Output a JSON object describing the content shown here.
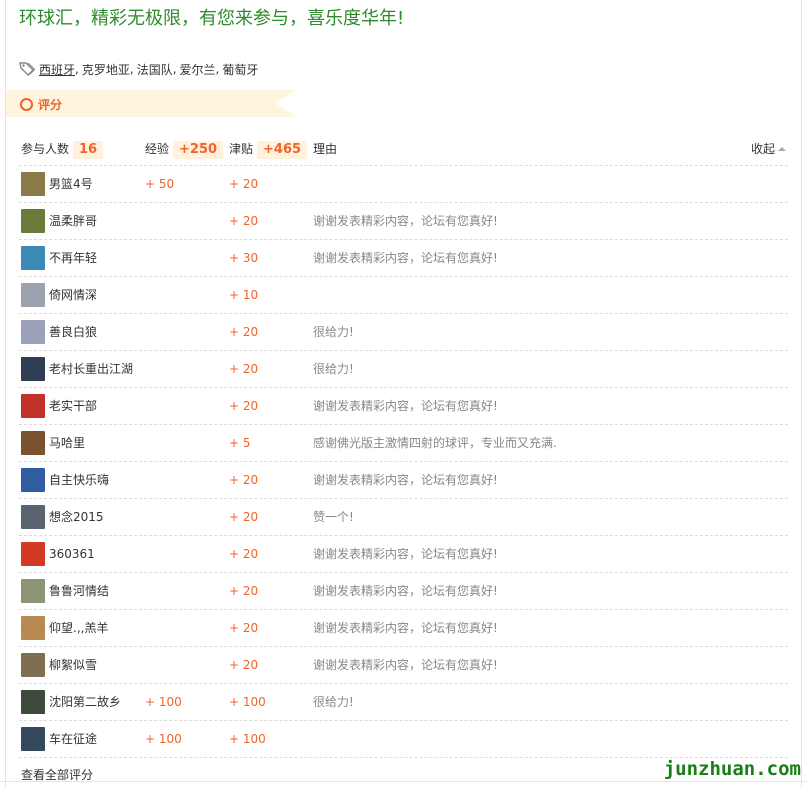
{
  "headline": "环球汇，精彩无极限，有您来参与，喜乐度华年!",
  "tags": [
    "西班牙",
    "克罗地亚",
    "法国队",
    "爱尔兰",
    "葡萄牙"
  ],
  "tag_separator": ",",
  "rate": {
    "title": "评分",
    "headers": {
      "participants_label": "参与人数",
      "participants_count": "16",
      "exp_label": "经验",
      "exp_total": "+250",
      "jt_label": "津贴",
      "jt_total": "+465",
      "reason_label": "理由",
      "collapse_label": "收起"
    },
    "rows": [
      {
        "name": "男篮4号",
        "exp": "+ 50",
        "jt": "+ 20",
        "reason": "",
        "avatar_color": "#8a7a4a",
        "avatar_icon": "avatar-photo-icon"
      },
      {
        "name": "温柔胖哥",
        "exp": "",
        "jt": "+ 20",
        "reason": "谢谢发表精彩内容，论坛有您真好!",
        "avatar_color": "#6b7b3a",
        "avatar_icon": "avatar-photo-icon"
      },
      {
        "name": "不再年轻",
        "exp": "",
        "jt": "+ 30",
        "reason": "谢谢发表精彩内容，论坛有您真好!",
        "avatar_color": "#3a8ab5",
        "avatar_icon": "avatar-photo-icon"
      },
      {
        "name": "倚网情深",
        "exp": "",
        "jt": "+ 10",
        "reason": "",
        "avatar_color": "#9aa3ad",
        "avatar_icon": "avatar-photo-icon"
      },
      {
        "name": "善良白狼",
        "exp": "",
        "jt": "+ 20",
        "reason": "很给力!",
        "avatar_color": "#9ba1b8",
        "avatar_icon": "avatar-photo-icon"
      },
      {
        "name": "老村长重出江湖",
        "exp": "",
        "jt": "+ 20",
        "reason": "很给力!",
        "avatar_color": "#2d3e55",
        "avatar_icon": "avatar-photo-icon"
      },
      {
        "name": "老实干部",
        "exp": "",
        "jt": "+ 20",
        "reason": "谢谢发表精彩内容，论坛有您真好!",
        "avatar_color": "#c2302a",
        "avatar_icon": "avatar-photo-icon"
      },
      {
        "name": "马哈里",
        "exp": "",
        "jt": "+ 5",
        "reason": "感谢佛光版主激情四射的球评，专业而又充满.",
        "avatar_color": "#7a5230",
        "avatar_icon": "avatar-photo-icon"
      },
      {
        "name": "自主快乐嗨",
        "exp": "",
        "jt": "+ 20",
        "reason": "谢谢发表精彩内容，论坛有您真好!",
        "avatar_color": "#2f5fa0",
        "avatar_icon": "avatar-photo-icon"
      },
      {
        "name": "想念2015",
        "exp": "",
        "jt": "+ 20",
        "reason": "赞一个!",
        "avatar_color": "#5a6470",
        "avatar_icon": "avatar-photo-icon"
      },
      {
        "name": "360361",
        "exp": "",
        "jt": "+ 20",
        "reason": "谢谢发表精彩内容，论坛有您真好!",
        "avatar_color": "#d23a24",
        "avatar_icon": "avatar-photo-icon"
      },
      {
        "name": "鲁鲁河情结",
        "exp": "",
        "jt": "+ 20",
        "reason": "谢谢发表精彩内容，论坛有您真好!",
        "avatar_color": "#8c9478",
        "avatar_icon": "avatar-photo-icon"
      },
      {
        "name": "仰望.,,羔羊",
        "exp": "",
        "jt": "+ 20",
        "reason": "谢谢发表精彩内容，论坛有您真好!",
        "avatar_color": "#b78a52",
        "avatar_icon": "avatar-photo-icon"
      },
      {
        "name": "柳絮似雪",
        "exp": "",
        "jt": "+ 20",
        "reason": "谢谢发表精彩内容，论坛有您真好!",
        "avatar_color": "#7f6f52",
        "avatar_icon": "avatar-photo-icon"
      },
      {
        "name": "沈阳第二故乡",
        "exp": "+ 100",
        "jt": "+ 100",
        "reason": "很给力!",
        "avatar_color": "#3c4a3a",
        "avatar_icon": "avatar-photo-icon"
      },
      {
        "name": "车在征途",
        "exp": "+ 100",
        "jt": "+ 100",
        "reason": "",
        "avatar_color": "#34495e",
        "avatar_icon": "avatar-photo-icon"
      }
    ],
    "view_all": "查看全部评分"
  },
  "watermark": "junzhuan.com",
  "colors": {
    "accent": "#f0642a",
    "headline": "#2e8b2e",
    "banner_bg": "#fff4dd",
    "watermark": "#1a7f14"
  }
}
